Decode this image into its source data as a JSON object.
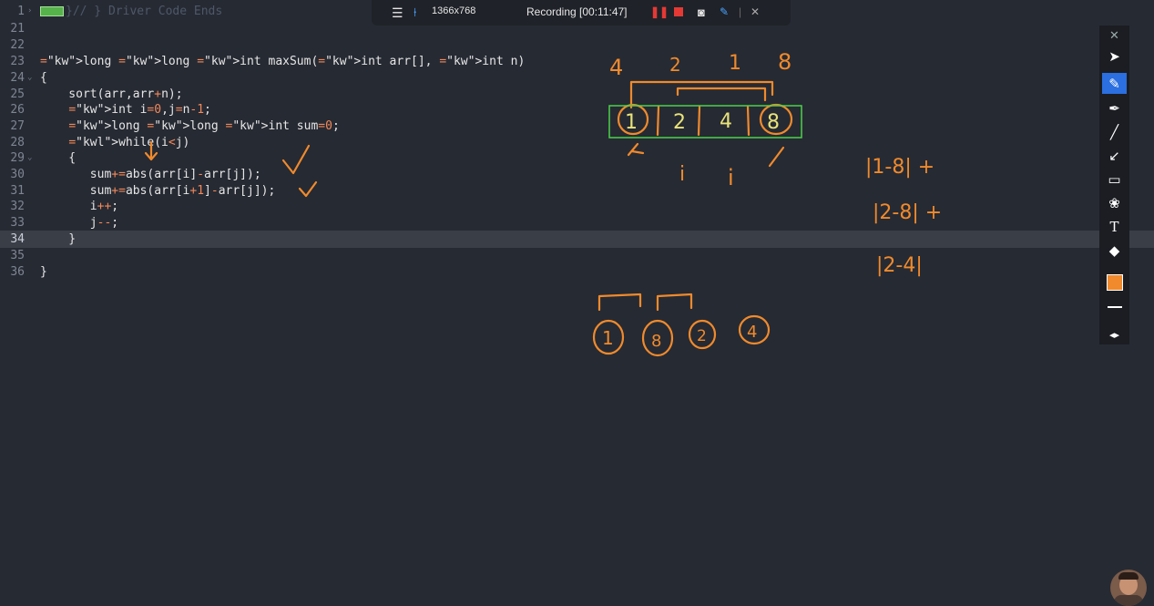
{
  "recording_bar": {
    "resolution": "1366x768",
    "status": "Recording [00:11:47]"
  },
  "code_lines": [
    {
      "n": "1",
      "text": "}// } Driver Code Ends"
    },
    {
      "n": "21",
      "text": ""
    },
    {
      "n": "22",
      "text": ""
    },
    {
      "n": "23",
      "text": "long long int maxSum(int arr[], int n)"
    },
    {
      "n": "24",
      "text": "{"
    },
    {
      "n": "25",
      "text": "    sort(arr,arr+n);"
    },
    {
      "n": "26",
      "text": "    int i=0,j=n-1;"
    },
    {
      "n": "27",
      "text": "    long long int sum=0;"
    },
    {
      "n": "28",
      "text": "    while(i<j)"
    },
    {
      "n": "29",
      "text": "    {"
    },
    {
      "n": "30",
      "text": "       sum+=abs(arr[i]-arr[j]);"
    },
    {
      "n": "31",
      "text": "       sum+=abs(arr[i+1]-arr[j]);"
    },
    {
      "n": "32",
      "text": "       i++;"
    },
    {
      "n": "33",
      "text": "       j--;"
    },
    {
      "n": "34",
      "text": "    }"
    },
    {
      "n": "35",
      "text": ""
    },
    {
      "n": "36",
      "text": "}"
    }
  ],
  "annotations": {
    "top_numbers": [
      "4",
      "2",
      "1",
      "8"
    ],
    "array_cells": [
      "1",
      "2",
      "4",
      "8"
    ],
    "cell_index_marks": [
      "i",
      "j"
    ],
    "sum_terms": [
      "|1-8| +",
      "|2-8| +",
      "|2-4|"
    ],
    "bottom_circled": [
      "1",
      "8",
      "2",
      "4"
    ]
  },
  "colors": {
    "ink_orange": "#f08a2c",
    "ink_yellow": "#e8e27a",
    "box_green": "#4bd24b",
    "bg": "#262a33",
    "accent_blue": "#2b6fe0"
  },
  "toolbar": {
    "tools": [
      "close-icon",
      "cursor-icon",
      "pen-icon",
      "marker-icon",
      "line-icon",
      "arrow-icon",
      "rectangle-icon",
      "stamp-icon",
      "text-icon",
      "eraser-icon",
      "color-swatch",
      "stroke-width",
      "expand-icon"
    ],
    "text_tool_label": "T"
  }
}
